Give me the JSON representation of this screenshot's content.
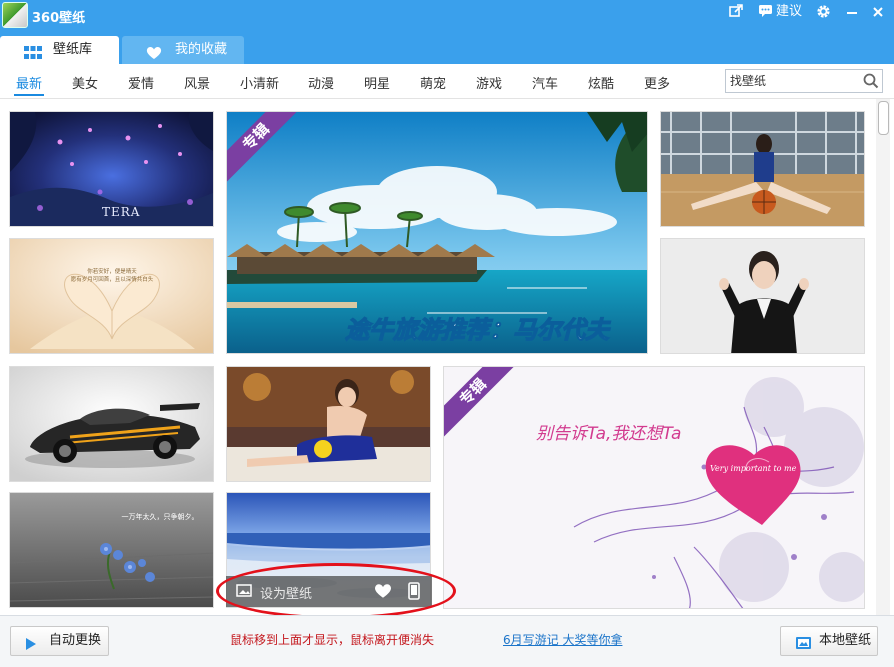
{
  "app": {
    "title": "360壁纸",
    "suggest_label": "建议"
  },
  "tabs": [
    {
      "label": "壁纸库",
      "active": true,
      "icon": "grid-icon"
    },
    {
      "label": "我的收藏",
      "active": false,
      "icon": "heart-icon"
    }
  ],
  "categories": [
    "最新",
    "美女",
    "爱情",
    "风景",
    "小清新",
    "动漫",
    "明星",
    "萌宠",
    "游戏",
    "汽车",
    "炫酷",
    "更多"
  ],
  "active_category": "最新",
  "search": {
    "placeholder": "找壁纸"
  },
  "tiles": {
    "tera_game": {
      "caption": "TERA"
    },
    "maldives": {
      "badge": "专辑",
      "caption": "途牛旅游推荐：马尔代夫"
    },
    "book_heart": {
      "caption_line1": "你若安好，便是晴天",
      "caption_line2": "愿有岁月可回首，且以深情共白头"
    },
    "valentine": {
      "badge": "专辑",
      "caption": "别告诉Ta,我还想Ta",
      "heart_text": "Very important to me"
    },
    "flower": {
      "caption": "一万年太久，只争朝夕。"
    }
  },
  "hover_overlay": {
    "set_wallpaper_label": "设为壁纸"
  },
  "footer": {
    "auto_change_label": "自动更换",
    "hint_text": "鼠标移到上面才显示，鼠标离开便消失",
    "promo_link": "6月写游记 大奖等你拿",
    "local_wallpaper_label": "本地壁纸"
  },
  "colors": {
    "titlebar": "#3aa0ec",
    "accent": "#1a8ae0",
    "album_badge": "#7b3fa2",
    "hint_red": "#c3161c",
    "annotation_red": "#e3111b"
  }
}
